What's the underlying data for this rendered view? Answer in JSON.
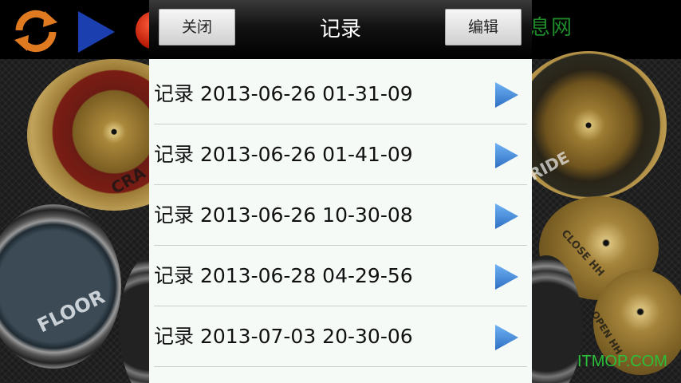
{
  "app": {
    "watermark_top": "息网",
    "watermark_bottom": "ITMOP.COM",
    "drum_labels": {
      "crash": "CRA",
      "ride": "RIDE",
      "close_hh": "CLOSE HH",
      "open_hh": "OPEN HH",
      "floor": "FLOOR"
    },
    "toolbar_icons": [
      "refresh-icon",
      "play-icon",
      "record-icon"
    ]
  },
  "dialog": {
    "title": "记录",
    "close_label": "关闭",
    "edit_label": "编辑",
    "records": [
      {
        "label": "记录 2013-06-26 01-31-09"
      },
      {
        "label": "记录 2013-06-26 01-41-09"
      },
      {
        "label": "记录 2013-06-26 10-30-08"
      },
      {
        "label": "记录 2013-06-28 04-29-56"
      },
      {
        "label": "记录 2013-07-03 20-30-06"
      }
    ]
  },
  "colors": {
    "play_arrow": "#3f86d8",
    "dialog_bg": "#f5faf7",
    "header_bg": "#000000",
    "watermark": "#2bbf3a"
  }
}
